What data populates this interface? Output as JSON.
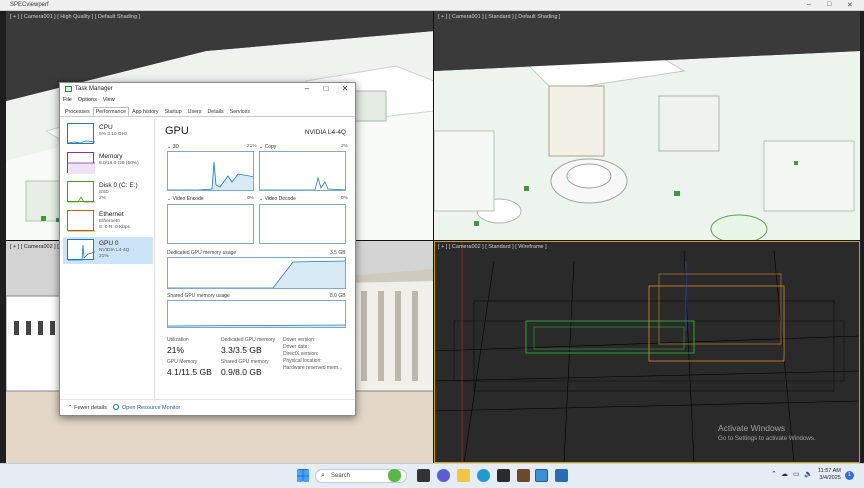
{
  "window": {
    "title": "SPECviewperf"
  },
  "viewports": {
    "top_left": {
      "label": "[ + ] [ Camera001 ] [ High Quality ] [ Default Shading ]"
    },
    "top_right": {
      "label": "[ + ] [ Camera001 ] [ Standard ] [ Default Shading ]"
    },
    "bottom_left": {
      "label": "[ + ] [ Camera002 ] [ Ur"
    },
    "bottom_right": {
      "label": "[ + ] [ Camera002 ] [ Standard ] [ Wireframe ]"
    }
  },
  "task_manager": {
    "title": "Task Manager",
    "menu": [
      "File",
      "Options",
      "View"
    ],
    "tabs": [
      "Processes",
      "Performance",
      "App history",
      "Startup",
      "Users",
      "Details",
      "Services"
    ],
    "active_tab": "Performance",
    "sidebar": [
      {
        "name": "CPU",
        "line1": "5%  3.10 GHz",
        "line2": "",
        "color": "#1f7ac0"
      },
      {
        "name": "Memory",
        "line1": "8.0/16.0 GB (50%)",
        "line2": "",
        "color": "#8b2db3"
      },
      {
        "name": "Disk 0 (C: E:)",
        "line1": "SSD",
        "line2": "2%",
        "color": "#4a9c1d"
      },
      {
        "name": "Ethernet",
        "line1": "Ethernet0",
        "line2": "S: 0  R: 0 Kbps",
        "color": "#c06010"
      },
      {
        "name": "GPU 0",
        "line1": "NVIDIA L4-4Q",
        "line2": "21%",
        "color": "#1f7ac0"
      }
    ],
    "selected": "GPU 0",
    "gpu": {
      "title": "GPU",
      "model": "NVIDIA L4-4Q",
      "engines": [
        {
          "name": "3D",
          "pct": "21%"
        },
        {
          "name": "Copy",
          "pct": "2%"
        },
        {
          "name": "Video Encode",
          "pct": "0%"
        },
        {
          "name": "Video Decode",
          "pct": "0%"
        }
      ],
      "dedicated_label": "Dedicated GPU memory usage",
      "dedicated_max": "3.5 GB",
      "shared_label": "Shared GPU memory usage",
      "shared_max": "8.0 GB",
      "stats": [
        {
          "label": "Utilization",
          "value": "21%"
        },
        {
          "label": "Dedicated GPU memory",
          "value": "3.3/3.5 GB"
        },
        {
          "label": "GPU Memory",
          "value": "4.1/11.5 GB"
        },
        {
          "label": "Shared GPU memory",
          "value": "0.9/8.0 GB"
        }
      ],
      "details": [
        "Driver version:",
        "Driver date:",
        "DirectX version:",
        "Physical location:",
        "Hardware reserved mem..."
      ]
    },
    "footer": {
      "fewer": "Fewer details",
      "resource_monitor": "Open Resource Monitor"
    }
  },
  "watermark": {
    "title": "Activate Windows",
    "subtitle": "Go to Settings to activate Windows."
  },
  "taskbar": {
    "search": "Search",
    "time": "11:57 AM",
    "date": "3/4/2025",
    "notifications": "1"
  }
}
